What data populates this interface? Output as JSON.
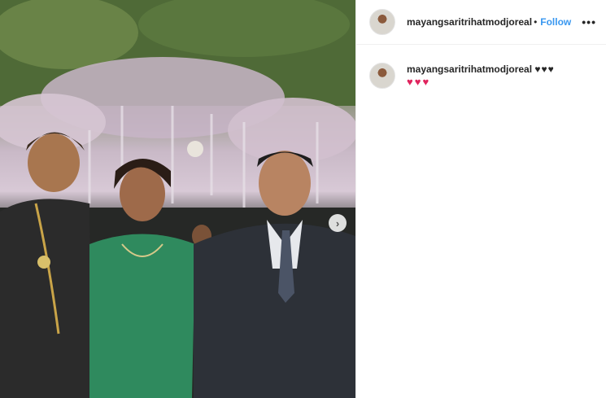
{
  "header": {
    "username": "mayangsaritrihatmodjoreal",
    "separator": "•",
    "follow_label": "Follow",
    "more_label": "•••"
  },
  "caption": {
    "username": "mayangsaritrihatmodjoreal",
    "hearts_black": "♥♥♥",
    "hearts_red": "♥♥♥"
  },
  "carousel": {
    "next_label": "›"
  },
  "colors": {
    "follow": "#3897f0",
    "text": "#262626",
    "heart_red": "#e0245e",
    "border": "#efefef"
  }
}
